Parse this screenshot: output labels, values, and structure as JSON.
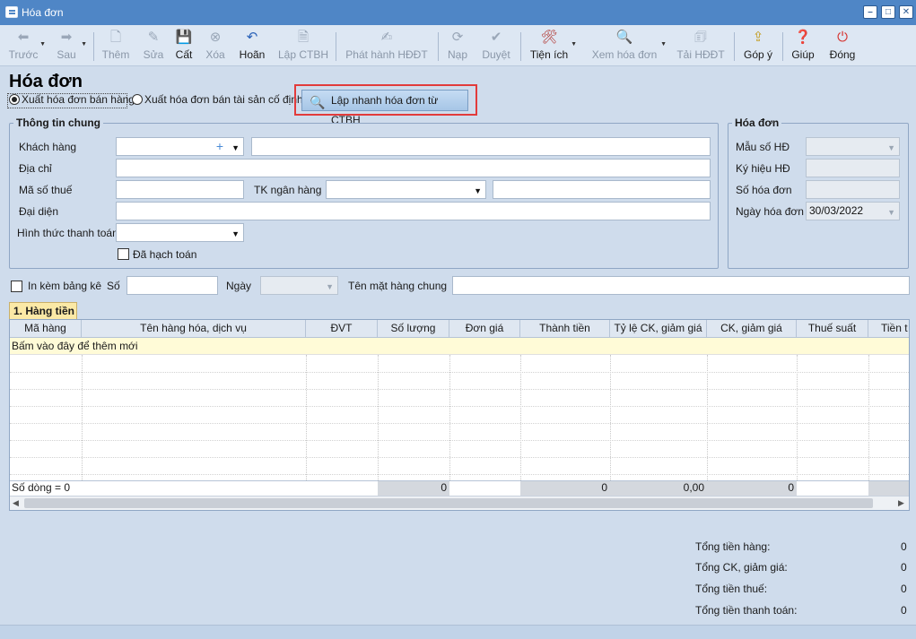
{
  "window": {
    "title": "Hóa đơn",
    "controls": [
      "–",
      "□",
      "✕"
    ]
  },
  "toolbar": {
    "truoc": "Trước",
    "sau": "Sau",
    "them": "Thêm",
    "sua": "Sửa",
    "cat": "Cất",
    "xoa": "Xóa",
    "hoan": "Hoãn",
    "lap_ctbh": "Lập CTBH",
    "phat_hanh": "Phát hành HĐĐT",
    "nap": "Nạp",
    "duyet": "Duyệt",
    "tien_ich": "Tiện ích",
    "xem_hoa_don": "Xem hóa đơn",
    "tai_hddt": "Tải HĐĐT",
    "gop_y": "Góp ý",
    "giup": "Giúp",
    "dong": "Đóng"
  },
  "page": {
    "title": "Hóa đơn",
    "radio_sales": "Xuất hóa đơn bán hàng",
    "radio_assets": "Xuất hóa đơn bán tài sản cố định",
    "quick_button": "Lập nhanh hóa đơn từ CTBH"
  },
  "general": {
    "legend": "Thông tin chung",
    "khach_hang": "Khách hàng",
    "dia_chi": "Địa chỉ",
    "ma_so_thue": "Mã số thuế",
    "tk_ngan_hang": "TK ngân hàng",
    "dai_dien": "Đại diện",
    "hinh_thuc": "Hình thức thanh toán",
    "da_hach_toan": "Đã hạch toán"
  },
  "invoice": {
    "legend": "Hóa đơn",
    "mau_so": "Mẫu số HĐ",
    "ky_hieu": "Ký hiệu HĐ",
    "so_hoa_don": "Số hóa đơn",
    "ngay_hoa_don": "Ngày hóa đơn",
    "ngay_value": "30/03/2022"
  },
  "extra": {
    "in_kem": "In kèm bảng kê",
    "so": "Số",
    "ngay": "Ngày",
    "ten_mat_hang": "Tên mặt hàng chung"
  },
  "tab": {
    "label": "1. Hàng tiền"
  },
  "grid": {
    "columns": [
      "Mã hàng",
      "Tên hàng hóa, dịch vụ",
      "ĐVT",
      "Số lượng",
      "Đơn giá",
      "Thành tiền",
      "Tỷ lệ CK, giảm giá",
      "CK, giảm giá",
      "Thuế suất",
      "Tiền t"
    ],
    "add_row": "Bấm vào đây để thêm mới",
    "footer": {
      "row_count": "Số dòng = 0",
      "qty": "0",
      "amount": "0",
      "rate": "0,00",
      "discount": "0"
    }
  },
  "totals": [
    {
      "label": "Tổng tiền hàng:",
      "value": "0"
    },
    {
      "label": "Tổng CK, giảm giá:",
      "value": "0"
    },
    {
      "label": "Tổng tiền thuế:",
      "value": "0"
    },
    {
      "label": "Tổng tiền thanh toán:",
      "value": "0"
    }
  ]
}
